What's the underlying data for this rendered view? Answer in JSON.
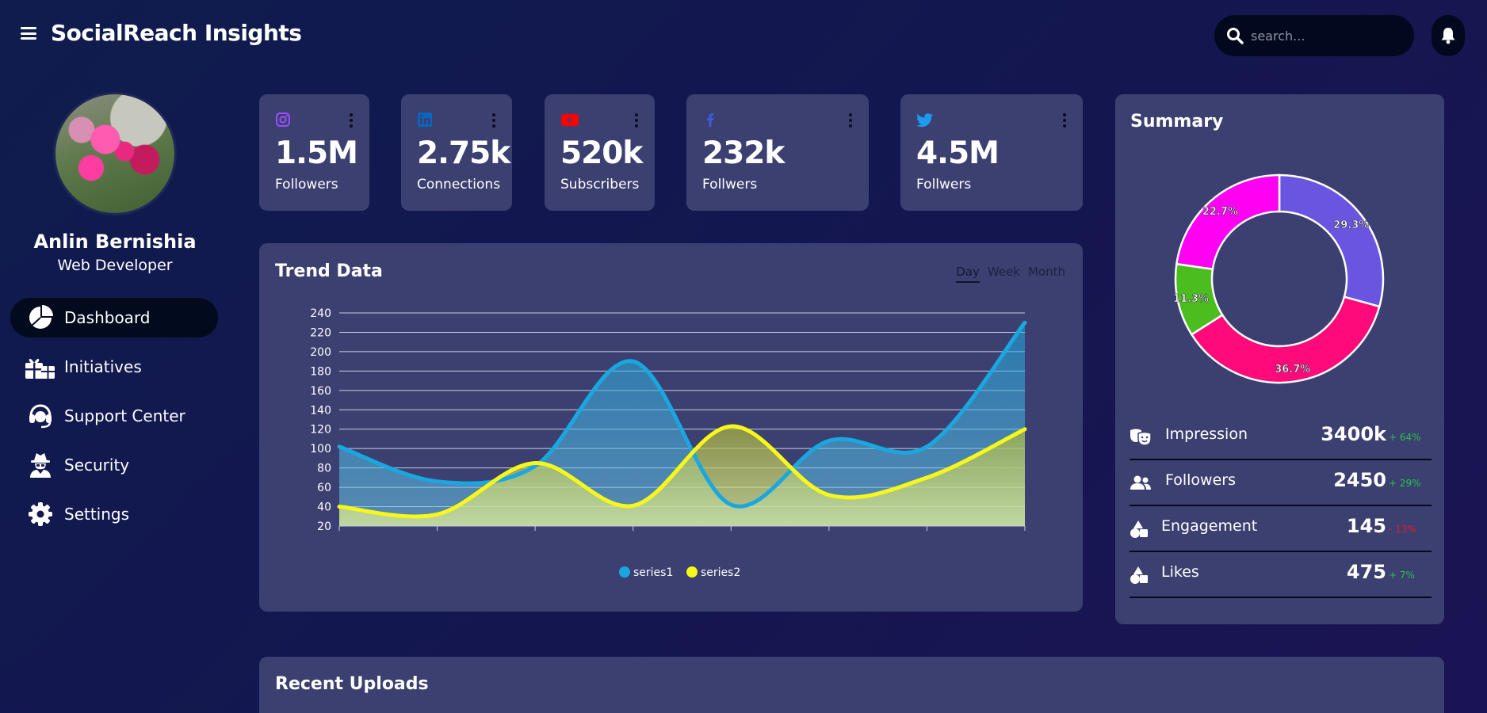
{
  "app": {
    "title": "SocialReach Insights"
  },
  "search": {
    "placeholder": "search..."
  },
  "user": {
    "name": "Anlin Bernishia",
    "role": "Web Developer"
  },
  "nav": [
    {
      "label": "Dashboard",
      "icon": "pie-chart-icon",
      "active": true
    },
    {
      "label": "Initiatives",
      "icon": "gift-icon",
      "active": false
    },
    {
      "label": "Support Center",
      "icon": "headset-icon",
      "active": false
    },
    {
      "label": "Security",
      "icon": "user-secret-icon",
      "active": false
    },
    {
      "label": "Settings",
      "icon": "gear-icon",
      "active": false
    }
  ],
  "stats": [
    {
      "platform": "instagram",
      "icon": "instagram-icon",
      "value": "1.5M",
      "label": "Followers",
      "color": "#9b4dff"
    },
    {
      "platform": "linkedin",
      "icon": "linkedin-icon",
      "value": "2.75k",
      "label": "Connections",
      "color": "#0a66c2"
    },
    {
      "platform": "youtube",
      "icon": "youtube-icon",
      "value": "520k",
      "label": "Subscribers",
      "color": "#ff0000"
    },
    {
      "platform": "facebook",
      "icon": "facebook-icon",
      "value": "232k",
      "label": "Follwers",
      "color": "#3b5bdb"
    },
    {
      "platform": "twitter",
      "icon": "twitter-icon",
      "value": "4.5M",
      "label": "Follwers",
      "color": "#1d9bf0"
    }
  ],
  "trend": {
    "title": "Trend Data",
    "tabs": [
      "Day",
      "Week",
      "Month"
    ],
    "active_tab": "Day"
  },
  "chart_data": {
    "type": "area",
    "categories": [
      "",
      "",
      "",
      "",
      "",
      "",
      "",
      ""
    ],
    "series": [
      {
        "name": "series1",
        "color": "#1aa7e0",
        "values": [
          102,
          66,
          82,
          190,
          42,
          108,
          102,
          230
        ]
      },
      {
        "name": "series2",
        "color": "#f7f71a",
        "values": [
          40,
          32,
          85,
          41,
          123,
          52,
          70,
          120
        ]
      }
    ],
    "y_ticks": [
      20,
      40,
      60,
      80,
      100,
      120,
      140,
      160,
      180,
      200,
      220,
      240
    ],
    "ylim": [
      20,
      240
    ],
    "grid": true,
    "legend": "bottom-center"
  },
  "summary": {
    "title": "Summary",
    "donut": [
      {
        "label": "29.3%",
        "value": 29.3,
        "color": "#6a55e0"
      },
      {
        "label": "36.7%",
        "value": 36.7,
        "color": "#ff0a7a"
      },
      {
        "label": "11.3%",
        "value": 11.3,
        "color": "#4cbd1e"
      },
      {
        "label": "22.7%",
        "value": 22.7,
        "color": "#ff00f2"
      }
    ],
    "rows": [
      {
        "icon": "masks-theater-icon",
        "label": "Impression",
        "value": "3400k",
        "change": "+ 64%",
        "trend": "up"
      },
      {
        "icon": "user-group-icon",
        "label": "Followers",
        "value": "2450",
        "change": "+ 29%",
        "trend": "up"
      },
      {
        "icon": "shapes-icon",
        "label": "Engagement",
        "value": "145",
        "change": "- 13%",
        "trend": "down"
      },
      {
        "icon": "shapes-icon",
        "label": "Likes",
        "value": "475",
        "change": "+ 7%",
        "trend": "up"
      }
    ]
  },
  "recent": {
    "title": "Recent Uploads"
  }
}
